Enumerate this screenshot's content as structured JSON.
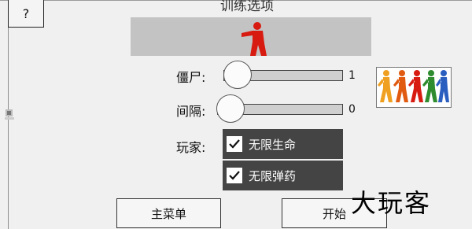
{
  "header": {
    "title": "训练选项",
    "help_label": "?"
  },
  "sliders": [
    {
      "label": "僵尸:",
      "value": "1"
    },
    {
      "label": "间隔:",
      "value": "0"
    }
  ],
  "player": {
    "label": "玩家:",
    "options": [
      {
        "label": "无限生命",
        "checked": true
      },
      {
        "label": "无限弹药",
        "checked": true
      }
    ]
  },
  "buttons": {
    "main_menu": "主菜单",
    "start": "开始"
  },
  "watermark": "大玩客",
  "icons": [
    "help-icon",
    "figure-preview-icon",
    "marching-figures-icon",
    "unknown-corner-icon",
    "checkmark-icon"
  ],
  "colors": {
    "preview_figure": "#d81b10",
    "checkbox_row": "#444444",
    "preview_bg": "#c3c3c3"
  }
}
